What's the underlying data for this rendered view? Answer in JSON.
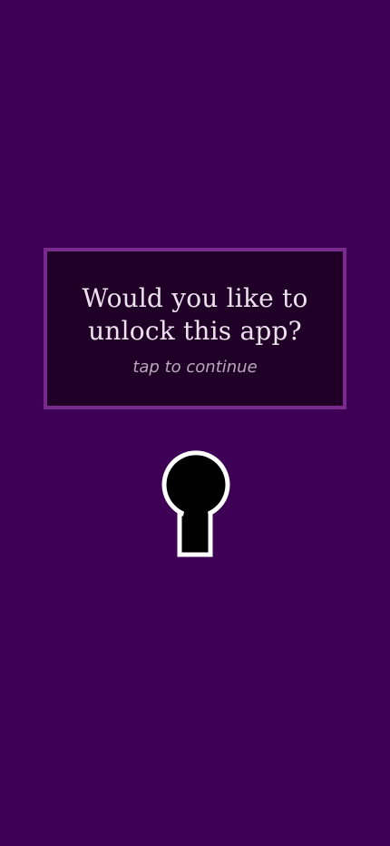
{
  "prompt": {
    "title_line1": "Would you like to",
    "title_line2": "unlock this app?",
    "subtitle": "tap to continue"
  },
  "colors": {
    "background": "#3e0055",
    "card_background": "#210027",
    "card_border": "#7a2a8f",
    "title_text": "#ece2ee",
    "subtitle_text": "#b7a8bb",
    "keyhole_fill": "#000000",
    "keyhole_stroke": "#ffffff"
  },
  "icons": {
    "keyhole": "keyhole-icon"
  }
}
